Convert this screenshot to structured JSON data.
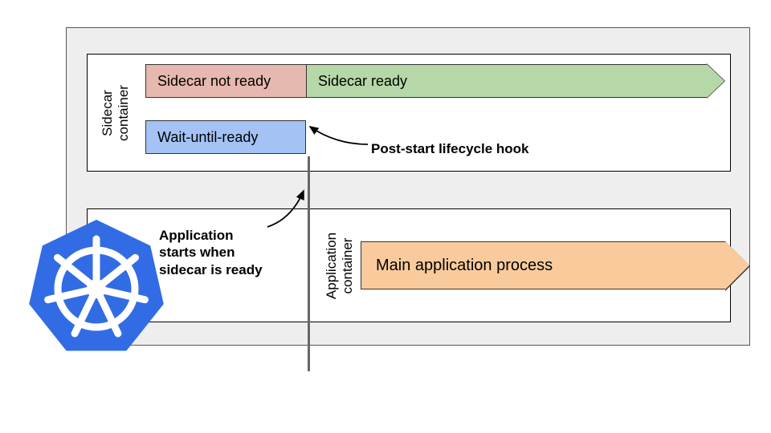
{
  "labels": {
    "sidecar_container": "Sidecar\ncontainer",
    "application_container": "Application\ncontainer"
  },
  "bars": {
    "sidecar_not_ready": "Sidecar not ready",
    "sidecar_ready": "Sidecar ready",
    "wait_until_ready": "Wait-until-ready",
    "main_app": "Main application process"
  },
  "annotations": {
    "post_start": "Post-start lifecycle hook",
    "app_starts": "Application\nstarts when\nsidecar is ready"
  },
  "colors": {
    "notready": "#e6b8af",
    "ready": "#b6d7a8",
    "wait": "#a4c2f4",
    "main": "#f9cb9c",
    "pod_bg": "#eeeeee",
    "k8s": "#326ce5"
  }
}
